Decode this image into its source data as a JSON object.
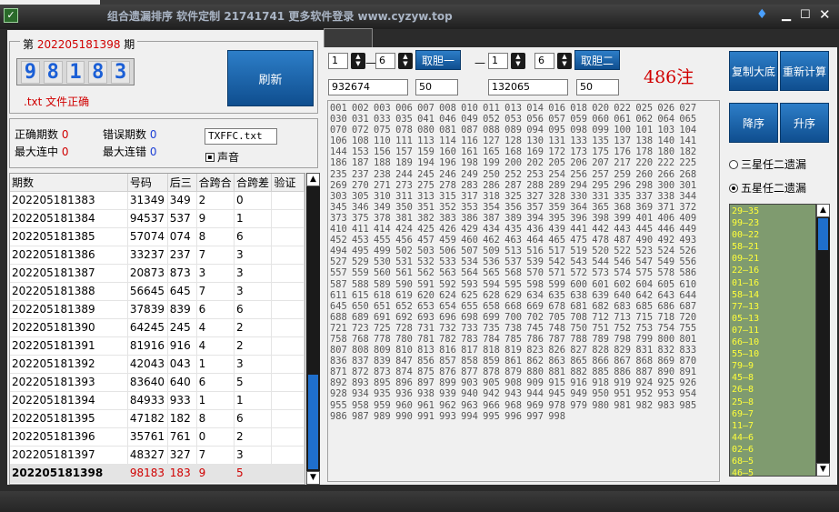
{
  "window": {
    "title": "组合遗漏排序 软件定制 21741741 更多软件登录 www.cyzyw.top",
    "app_icon_glyph": "✓"
  },
  "issue": {
    "prefix": "第",
    "number": "202205181398",
    "suffix": "期",
    "digits": [
      "9",
      "8",
      "1",
      "8",
      "3"
    ],
    "file_status": ".txt 文件正确"
  },
  "refresh_label": "刷新",
  "stats": {
    "correct_label": "正确期数",
    "correct_value": "0",
    "error_label": "错误期数",
    "error_value": "0",
    "max_hit_label": "最大连中",
    "max_hit_value": "0",
    "max_err_label": "最大连错",
    "max_err_value": "0",
    "file_name": "TXFFC.txt",
    "sound_label": "声音"
  },
  "table": {
    "headers": [
      "期数",
      "号码",
      "后三",
      "合跨合",
      "合跨差",
      "验证"
    ],
    "rows": [
      [
        "202205181383",
        "31349",
        "349",
        "2",
        "0",
        ""
      ],
      [
        "202205181384",
        "94537",
        "537",
        "9",
        "1",
        ""
      ],
      [
        "202205181385",
        "57074",
        "074",
        "8",
        "6",
        ""
      ],
      [
        "202205181386",
        "33237",
        "237",
        "7",
        "3",
        ""
      ],
      [
        "202205181387",
        "20873",
        "873",
        "3",
        "3",
        ""
      ],
      [
        "202205181388",
        "56645",
        "645",
        "7",
        "3",
        ""
      ],
      [
        "202205181389",
        "37839",
        "839",
        "6",
        "6",
        ""
      ],
      [
        "202205181390",
        "64245",
        "245",
        "4",
        "2",
        ""
      ],
      [
        "202205181391",
        "81916",
        "916",
        "4",
        "2",
        ""
      ],
      [
        "202205181392",
        "42043",
        "043",
        "1",
        "3",
        ""
      ],
      [
        "202205181393",
        "83640",
        "640",
        "6",
        "5",
        ""
      ],
      [
        "202205181394",
        "84933",
        "933",
        "1",
        "1",
        ""
      ],
      [
        "202205181395",
        "47182",
        "182",
        "8",
        "6",
        ""
      ],
      [
        "202205181396",
        "35761",
        "761",
        "0",
        "2",
        ""
      ],
      [
        "202205181397",
        "48327",
        "327",
        "7",
        "3",
        ""
      ],
      [
        "202205181398",
        "98183",
        "183",
        "9",
        "5",
        ""
      ]
    ]
  },
  "controls": {
    "group1": {
      "from": "1",
      "to": "6",
      "button": "取胆一",
      "text": "932674",
      "count": "50"
    },
    "group2": {
      "from": "1",
      "to": "6",
      "button": "取胆二",
      "text": "132065",
      "count": "50"
    },
    "dash": "—",
    "result_count": "486注",
    "copy_label": "复制大底",
    "recalc_label": "重新计算",
    "desc_label": "降序",
    "asc_label": "升序",
    "radio1_label": "三星任二遗漏",
    "radio2_label": "五星任二遗漏"
  },
  "numbers_text": "001 002 003 006 007 008 010 011 013 014 016 018 020 022 025 026 027 030 031 033 035 041 046 049 052 053 056 057 059 060 061 062 064 065 070 072 075 078 080 081 087 088 089 094 095 098 099 100 101 103 104 106 108 110 111 113 114 116 127 128 130 131 133 135 137 138 140 141 144 153 156 157 159 160 161 165 168 169 172 173 175 176 178 180 182 186 187 188 189 194 196 198 199 200 202 205 206 207 217 220 222 225 235 237 238 244 245 246 249 250 252 253 254 256 257 259 260 266 268 269 270 271 273 275 278 283 286 287 288 289 294 295 296 298 300 301 303 305 310 311 313 315 317 318 325 327 328 330 331 335 337 338 344 345 346 349 350 351 352 353 354 356 357 359 364 365 368 369 371 372 373 375 378 381 382 383 386 387 389 394 395 396 398 399 401 406 409 410 411 414 424 425 426 429 434 435 436 439 441 442 443 445 446 449 452 453 455 456 457 459 460 462 463 464 465 475 478 487 490 492 493 494 495 499 502 503 506 507 509 513 516 517 519 520 522 523 524 526 527 529 530 531 532 533 534 536 537 539 542 543 544 546 547 549 556 557 559 560 561 562 563 564 565 568 570 571 572 573 574 575 578 586 587 588 589 590 591 592 593 594 595 598 599 600 601 602 604 605 610 611 615 618 619 620 624 625 628 629 634 635 638 639 640 642 643 644 645 650 651 652 653 654 655 658 668 669 678 681 682 683 685 686 687 688 689 691 692 693 696 698 699 700 702 705 708 712 713 715 718 720 721 723 725 728 731 732 733 735 738 745 748 750 751 752 753 754 755 758 768 778 780 781 782 783 784 785 786 787 788 789 798 799 800 801 807 808 809 810 813 816 817 818 819 823 826 827 828 829 831 832 833 836 837 839 847 856 857 858 859 861 862 863 865 866 867 868 869 870 871 872 873 874 875 876 877 878 879 880 881 882 885 886 887 890 891 892 893 895 896 897 899 903 905 908 909 915 916 918 919 924 925 926 928 934 935 936 938 939 940 942 943 944 945 949 950 951 952 953 954 955 958 959 960 961 962 963 966 968 969 978 979 980 981 982 983 985 986 987 989 990 991 993 994 995 996 997 998",
  "miss_list": [
    "29—35",
    "99—23",
    "00—22",
    "58—21",
    "09—21",
    "22—16",
    "01—16",
    "58—14",
    "77—13",
    "05—13",
    "07—11",
    "66—10",
    "55—10",
    "79—9",
    "45—8",
    "26—8",
    "25—8",
    "69—7",
    "11—7",
    "44—6",
    "02—6",
    "68—5",
    "46—5"
  ],
  "icons": {
    "minimize": "minimize-icon",
    "maximize": "maximize-icon",
    "close": "close-icon",
    "skin": "skin-icon",
    "scroll_up": "scroll-up-icon",
    "scroll_down": "scroll-down-icon"
  },
  "colors": {
    "accent_blue": "#1f6fcc",
    "red": "#d00000",
    "miss_bg": "#7f9b6f",
    "miss_fg": "#ffff3a"
  }
}
